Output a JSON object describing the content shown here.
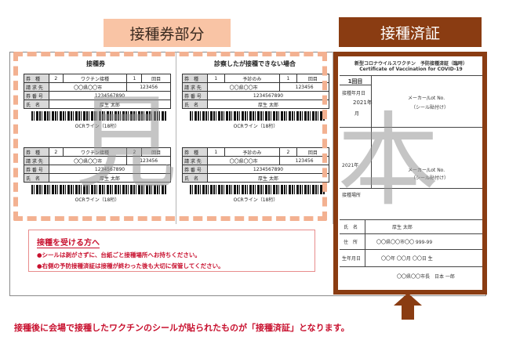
{
  "labels": {
    "left": "接種券部分",
    "right": "接種済証"
  },
  "sheet": {
    "left_header": "接種券",
    "middle_header": "診察したが接種できない場合"
  },
  "tickets": [
    {
      "rows": [
        [
          "券　種",
          "2",
          "ワクチン接種",
          "1",
          "回目"
        ],
        [
          "請 求 先",
          "〇〇県〇〇市",
          "123456"
        ],
        [
          "券 番 号",
          "1234567890"
        ],
        [
          "氏　名",
          "厚生 太郎"
        ]
      ],
      "ocr": "OCRライン（18桁）"
    },
    {
      "rows": [
        [
          "券　種",
          "1",
          "予診のみ",
          "1",
          "回目"
        ],
        [
          "請 求 先",
          "〇〇県〇〇市",
          "123456"
        ],
        [
          "券 番 号",
          "1234567890"
        ],
        [
          "氏　名",
          "厚生 太郎"
        ]
      ],
      "ocr": "OCRライン（18桁）"
    },
    {
      "rows": [
        [
          "券　種",
          "2",
          "ワクチン接種",
          "2",
          "回目"
        ],
        [
          "請 求 先",
          "〇〇県〇〇市",
          "123456"
        ],
        [
          "券 番 号",
          "1234567890"
        ],
        [
          "氏　名",
          "厚生 太郎"
        ]
      ],
      "ocr": "OCRライン（18桁）"
    },
    {
      "rows": [
        [
          "券　種",
          "1",
          "予診のみ",
          "2",
          "回目"
        ],
        [
          "請 求 先",
          "〇〇県〇〇市",
          "123456"
        ],
        [
          "券 番 号",
          "1234567890"
        ],
        [
          "氏　名",
          "厚生 太郎"
        ]
      ],
      "ocr": "OCRライン（18桁）"
    }
  ],
  "notice": {
    "title": "接種を受ける方へ",
    "line1": "●シールは剥がさずに、台紙ごと接種場所へお持ちください。",
    "line2": "●右側の予防接種済証は接種が終わった後も大切に保管してください。"
  },
  "certificate": {
    "title_jp": "新型コロナウイルスワクチン　予防接種済証（臨時）",
    "title_en": "Certificate of Vaccination for COVID-19",
    "dose1": "1回目",
    "date_label": "接種年月日",
    "year": "2021年",
    "month": "月",
    "maker_lot": "メーカー/Lot No.",
    "sticker": "（シール貼付け）",
    "place_label": "接種場所",
    "name_label": "氏　名",
    "name_value": "厚生 太郎",
    "address_label": "住　所",
    "address_value": "〇〇県〇〇市〇〇 999-99",
    "birth_label": "生年月日",
    "birth_value": "〇〇年 〇〇月 〇〇日 生",
    "issuer": "〇〇県〇〇市長　日本 一郎"
  },
  "watermark": {
    "char1": "見",
    "char2": "本"
  },
  "footer": "接種後に会場で接種したワクチンのシールが貼られたものが「接種済証」となります。",
  "colors": {
    "accent_brown": "#8a3c12",
    "accent_peach": "#f9c4a5",
    "text_red": "#c8102e"
  }
}
